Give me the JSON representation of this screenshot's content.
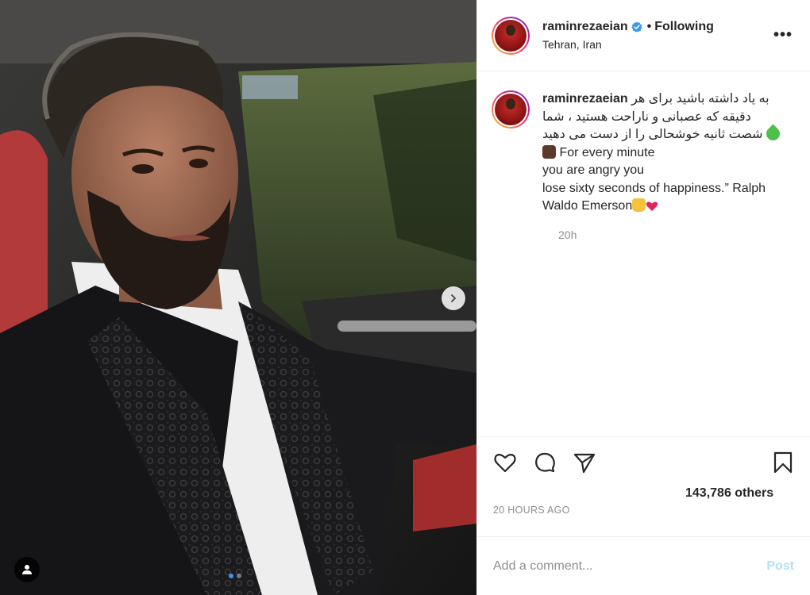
{
  "post": {
    "carousel": {
      "slide_count": 2,
      "active_slide": 1,
      "next_icon": "chevron-right-icon",
      "tag_icon": "user-tag-icon"
    },
    "header": {
      "username": "raminrezaeian",
      "verified": true,
      "separator": "•",
      "follow_status": "Following",
      "location": "Tehran, Iran",
      "more_icon": "more-horizontal-icon",
      "more_label": "•••"
    },
    "caption": {
      "username": "raminrezaeian",
      "text_fa": "به یاد داشته باشید برای هر دقیقه که عصبانی و ناراحت هستید ، شما شصت ثانیه خوشحالی را از دست می دهید",
      "text_en_1": "For every minute",
      "text_en_2": "you are angry you",
      "text_en_3": "lose sixty seconds of happiness.” Ralph",
      "text_en_4": "Waldo Emerson",
      "time": "20h"
    },
    "actions": {
      "like_icon": "heart-icon",
      "comment_icon": "comment-icon",
      "share_icon": "paper-plane-icon",
      "save_icon": "bookmark-icon",
      "likes": "143,786 others"
    },
    "timestamp": "20 HOURS AGO",
    "comment": {
      "placeholder": "Add a comment...",
      "post_label": "Post"
    },
    "colors": {
      "verified": "#3897f0",
      "post_disabled": "#b2dffc",
      "muted": "#8e8e8e"
    }
  }
}
